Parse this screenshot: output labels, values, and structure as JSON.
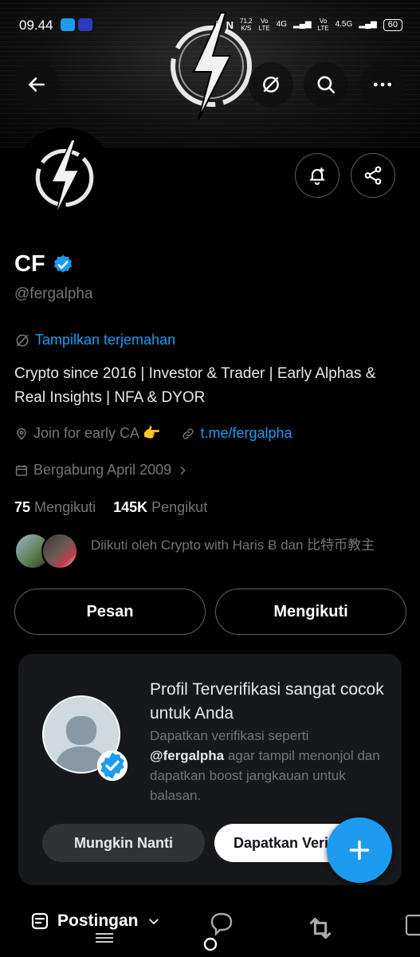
{
  "status_bar": {
    "time": "09.44",
    "speed_value": "71,2",
    "speed_unit": "K/S",
    "sim1": "Vo",
    "sim1_sub": "LTE",
    "net1": "4G",
    "sim2": "Vo",
    "sim2_sub": "LTE",
    "net2": "4.5G",
    "battery": "60"
  },
  "profile": {
    "name": "CF",
    "handle": "@fergalpha",
    "translate_label": "Tampilkan terjemahan",
    "bio": "Crypto since 2016 | Investor & Trader | Early Alphas & Real Insights | NFA & DYOR",
    "location": "Join for early CA 👉",
    "link": "t.me/fergalpha",
    "joined": "Bergabung April 2009",
    "following_count": "75",
    "following_label": "Mengikuti",
    "followers_count": "145K",
    "followers_label": "Pengikut",
    "followed_by": "Diikuti oleh Crypto with Haris Ƀ dan 比特币教主"
  },
  "actions": {
    "message": "Pesan",
    "following": "Mengikuti"
  },
  "verify_card": {
    "title": "Profil Terverifikasi sangat cocok untuk Anda",
    "desc_before": "Dapatkan verifikasi seperti ",
    "desc_handle": "@fergalpha",
    "desc_after": " agar tampil menonjol dan dapatkan boost jangkauan untuk balasan.",
    "later_button": "Mungkin Nanti",
    "get_button": "Dapatkan Verifikasi"
  },
  "tabs": {
    "posts": "Postingan"
  },
  "colors": {
    "accent": "#1d9bf0",
    "muted": "#71767b",
    "card": "#16181c"
  }
}
